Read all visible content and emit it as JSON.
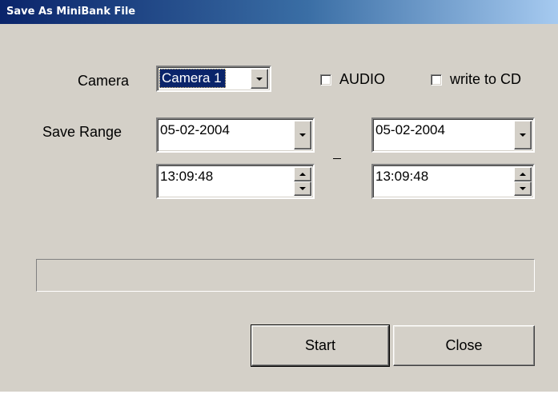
{
  "window": {
    "title": "Save As MiniBank File"
  },
  "camera": {
    "label": "Camera",
    "selected": "Camera 1"
  },
  "options": {
    "audio": {
      "label": "AUDIO",
      "checked": false
    },
    "write_cd": {
      "label": "write to CD",
      "checked": false
    }
  },
  "range": {
    "label": "Save Range",
    "separator": "–",
    "start": {
      "date": "05-02-2004",
      "time": "13:09:48"
    },
    "end": {
      "date": "05-02-2004",
      "time": "13:09:48"
    }
  },
  "progress": {
    "value": 0
  },
  "buttons": {
    "start": "Start",
    "close": "Close"
  },
  "colors": {
    "title_bar_start": "#0a246a",
    "title_bar_end": "#a6caf0",
    "face": "#d4d0c8",
    "selection": "#0a246a"
  },
  "icons": [
    "dropdown-arrow-icon",
    "spin-up-icon",
    "spin-down-icon",
    "checkbox-icon"
  ]
}
